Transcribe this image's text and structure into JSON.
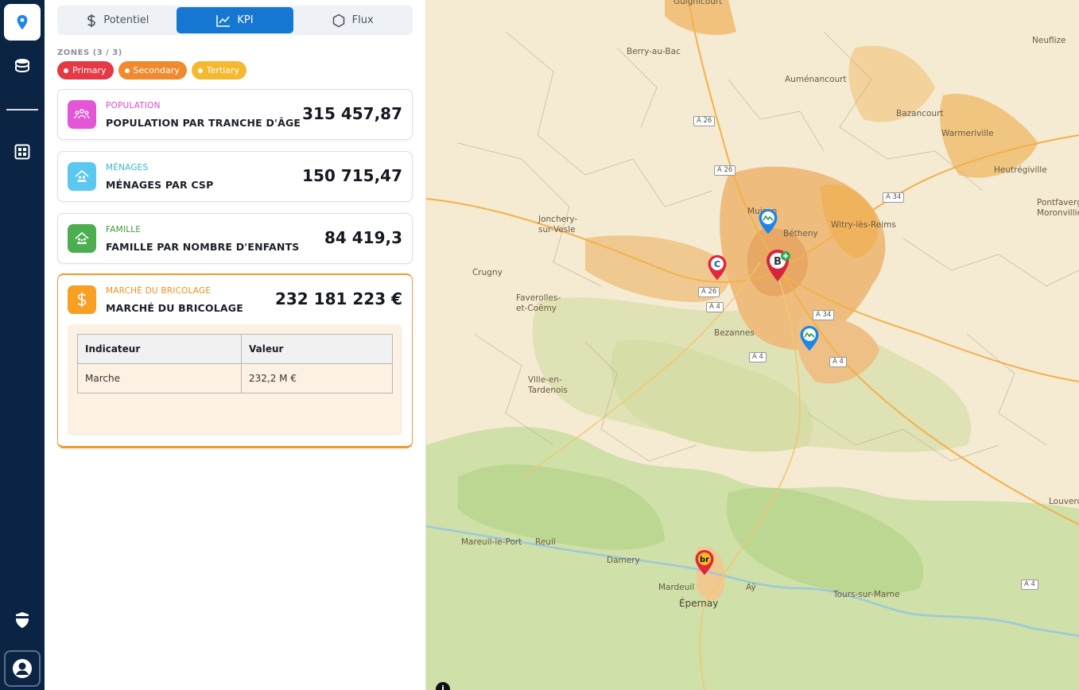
{
  "rail": {
    "items": [
      {
        "name": "map-pin-icon",
        "active": true
      },
      {
        "name": "database-icon",
        "active": false
      },
      {
        "name": "dashboard-grid-icon",
        "active": false
      }
    ],
    "bottom": [
      {
        "name": "shield-icon"
      },
      {
        "name": "user-avatar-icon"
      }
    ]
  },
  "tabs": [
    {
      "label": "Potentiel",
      "icon": "dollar-icon",
      "active": false
    },
    {
      "label": "KPI",
      "icon": "line-chart-icon",
      "active": true
    },
    {
      "label": "Flux",
      "icon": "hexagon-icon",
      "active": false
    }
  ],
  "zones": {
    "label": "ZONES (3 / 3)",
    "chips": [
      {
        "label": "Primary",
        "color": "#e63946"
      },
      {
        "label": "Secondary",
        "color": "#f08a2c"
      },
      {
        "label": "Tertiary",
        "color": "#f5b82e"
      }
    ]
  },
  "kpis": [
    {
      "category": "POPULATION",
      "name": "POPULATION PAR TRANCHE D'ÂGE",
      "value": "315 457,87",
      "icon": "people-group-icon",
      "color": "#e356d6"
    },
    {
      "category": "MÉNAGES",
      "name": "MÉNAGES PAR CSP",
      "value": "150 715,47",
      "icon": "household-icon",
      "color": "#5bc8f0"
    },
    {
      "category": "FAMILLE",
      "name": "FAMILLE PAR NOMBRE D'ENFANTS",
      "value": "84 419,3",
      "icon": "family-home-icon",
      "color": "#4cae4f"
    }
  ],
  "market": {
    "category": "MARCHÉ DU BRICOLAGE",
    "name": "MARCHÉ DU BRICOLAGE",
    "value": "232 181 223 €",
    "icon": "dollar-icon",
    "color": "#f7a024",
    "table": {
      "headers": [
        "Indicateur",
        "Valeur"
      ],
      "rows": [
        [
          "Marche",
          "232,2 M €"
        ]
      ]
    }
  },
  "map": {
    "places": [
      "Guignicourt",
      "Neuflize",
      "Berry-au-Bac",
      "Auménancourt",
      "Bazancourt",
      "Warmeriville",
      "Heutrégiville",
      "Pontfaverger-Moronvilliers",
      "Witry-lès-Reims",
      "Bétheny",
      "Muizon",
      "Jonchery-sur-Vesle",
      "Crugny",
      "Faverolles-et-Coëmy",
      "Bezannes",
      "Ville-en-Tardenois",
      "Mareuil-le-Port",
      "Reuil",
      "Damery",
      "Mardeuil",
      "Épernay",
      "Aÿ",
      "Tours-sur-Marne",
      "Louvercy"
    ],
    "roads": [
      "A 26",
      "A 26",
      "A 34",
      "A 26",
      "A 4",
      "A 34",
      "A 4",
      "A 4",
      "A 4"
    ],
    "pins": [
      "competitor-pin-blue",
      "competitor-pin-red-c",
      "store-pin-b",
      "competitor-pin-blue-2",
      "competitor-pin-br"
    ],
    "info": "i"
  }
}
